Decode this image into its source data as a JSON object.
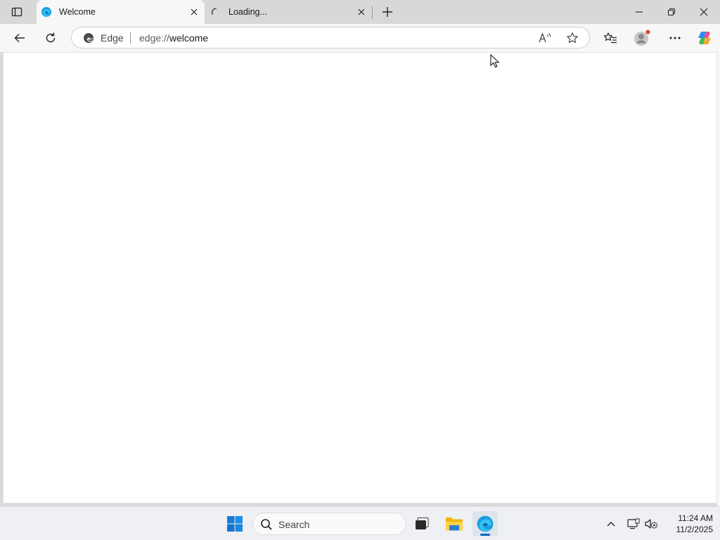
{
  "browser": {
    "tabs": [
      {
        "title": "Welcome",
        "active": true
      },
      {
        "title": "Loading...",
        "active": false
      }
    ],
    "address": {
      "site_label": "Edge",
      "url_prefix": "edge://",
      "url_host": "welcome"
    }
  },
  "taskbar": {
    "search_placeholder": "Search",
    "clock_time": "11:24 AM",
    "clock_date": "11/2/2025"
  },
  "colors": {
    "accent": "#0067c0",
    "titlebar": "#d8d8d8",
    "toolbar": "#f7f7f7"
  }
}
